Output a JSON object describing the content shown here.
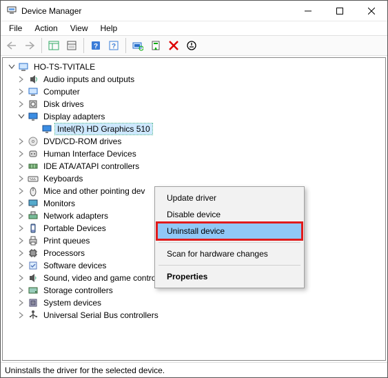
{
  "window": {
    "title": "Device Manager"
  },
  "menubar": [
    "File",
    "Action",
    "View",
    "Help"
  ],
  "tree": {
    "root": "HO-TS-TVITALE",
    "categories": [
      {
        "label": "Audio inputs and outputs",
        "icon": "speaker"
      },
      {
        "label": "Computer",
        "icon": "computer"
      },
      {
        "label": "Disk drives",
        "icon": "disk"
      },
      {
        "label": "Display adapters",
        "icon": "display",
        "expanded": true,
        "children": [
          {
            "label": "Intel(R) HD Graphics 510",
            "icon": "display",
            "selected": false
          }
        ]
      },
      {
        "label": "DVD/CD-ROM drives",
        "icon": "dvd"
      },
      {
        "label": "Human Interface Devices",
        "icon": "hid"
      },
      {
        "label": "IDE ATA/ATAPI controllers",
        "icon": "ide"
      },
      {
        "label": "Keyboards",
        "icon": "keyboard"
      },
      {
        "label": "Mice and other pointing devices",
        "icon": "mouse",
        "truncated": "Mice and other pointing dev"
      },
      {
        "label": "Monitors",
        "icon": "monitor"
      },
      {
        "label": "Network adapters",
        "icon": "network"
      },
      {
        "label": "Portable Devices",
        "icon": "portable"
      },
      {
        "label": "Print queues",
        "icon": "printer"
      },
      {
        "label": "Processors",
        "icon": "cpu"
      },
      {
        "label": "Software devices",
        "icon": "software"
      },
      {
        "label": "Sound, video and game controllers",
        "icon": "sound"
      },
      {
        "label": "Storage controllers",
        "icon": "storage"
      },
      {
        "label": "System devices",
        "icon": "system"
      },
      {
        "label": "Universal Serial Bus controllers",
        "icon": "usb"
      }
    ]
  },
  "context_menu": {
    "items": [
      {
        "label": "Update driver"
      },
      {
        "label": "Disable device"
      },
      {
        "label": "Uninstall device",
        "highlighted": true
      },
      {
        "type": "sep"
      },
      {
        "label": "Scan for hardware changes"
      },
      {
        "type": "sep"
      },
      {
        "label": "Properties",
        "bold": true
      }
    ]
  },
  "statusbar": {
    "text": "Uninstalls the driver for the selected device."
  }
}
